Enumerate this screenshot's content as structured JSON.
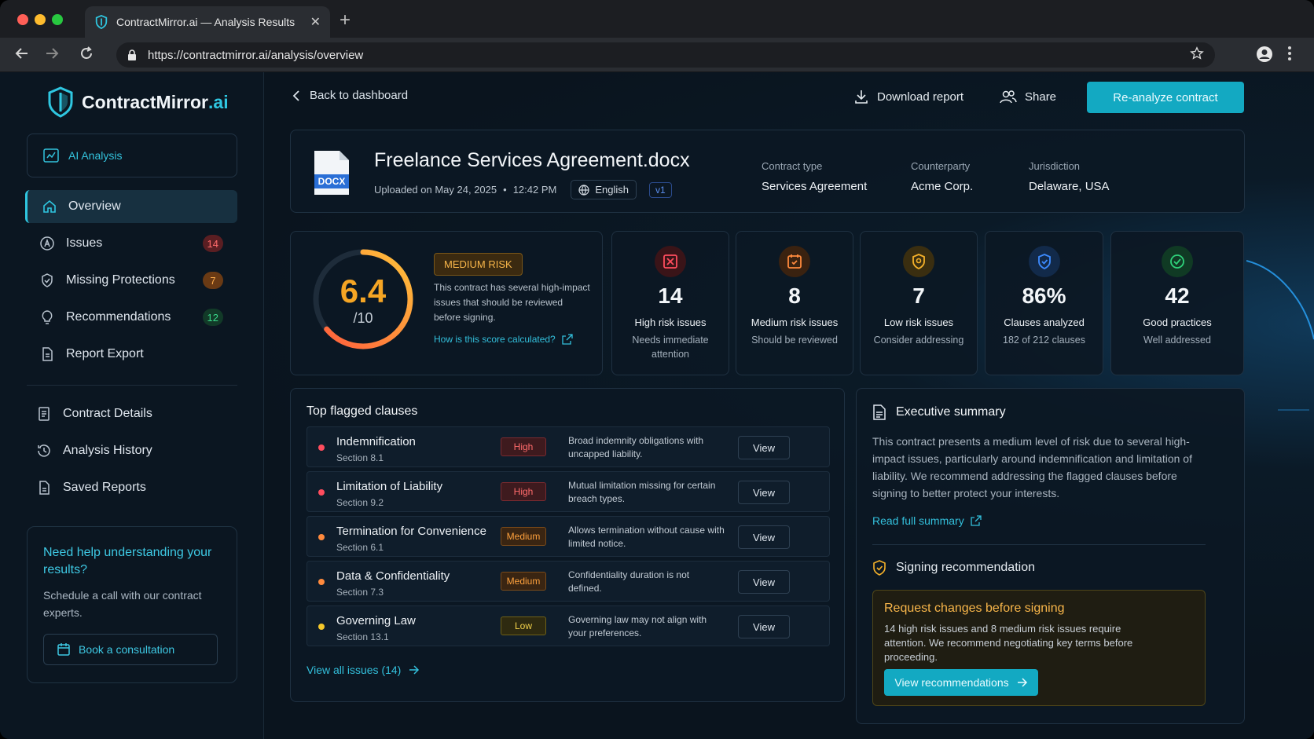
{
  "browser": {
    "tab_title": "ContractMirror.ai — Analysis Results",
    "url": "https://contractmirror.ai/analysis/overview",
    "icons": [
      "back-arrow-icon",
      "forward-arrow-icon",
      "reload-icon",
      "lock-icon",
      "star-icon",
      "profile-icon",
      "more-icon"
    ]
  },
  "brand": {
    "name": "ContractMirror",
    "suffix": ".ai",
    "accent": "#2fc6e0"
  },
  "sidebar": {
    "ai_label": "AI Analysis",
    "nav": [
      {
        "label": "Overview",
        "icon": "home-icon",
        "active": true
      },
      {
        "label": "Issues",
        "icon": "alert-icon",
        "badge": "14",
        "badge_color": "#ff6b6b"
      },
      {
        "label": "Missing Protections",
        "icon": "shield-check-icon",
        "badge": "7",
        "badge_color": "#ffae4d"
      },
      {
        "label": "Recommendations",
        "icon": "lightbulb-icon",
        "badge": "12",
        "badge_color": "#39d98a"
      },
      {
        "label": "Report Export",
        "icon": "file-icon"
      }
    ],
    "secondary": [
      {
        "label": "Contract Details",
        "icon": "document-icon"
      },
      {
        "label": "Analysis History",
        "icon": "history-icon"
      },
      {
        "label": "Saved Reports",
        "icon": "saved-file-icon"
      }
    ],
    "help": {
      "title": "Need help understanding your results?",
      "text": "Schedule a call with our contract experts.",
      "button": "Book a consultation"
    }
  },
  "topbar": {
    "back": "Back to dashboard",
    "download": "Download report",
    "share": "Share",
    "reanalyze": "Re-analyze contract"
  },
  "document": {
    "file_type": "DOCX",
    "name": "Freelance Services Agreement.docx",
    "uploaded": "Uploaded on May 24, 2025",
    "time": "12:42 PM",
    "language": "English",
    "version": "v1",
    "meta": [
      {
        "label": "Contract type",
        "value": "Services Agreement"
      },
      {
        "label": "Counterparty",
        "value": "Acme Corp."
      },
      {
        "label": "Jurisdiction",
        "value": "Delaware, USA"
      }
    ]
  },
  "score": {
    "value": "6.4",
    "max": "/10",
    "fraction": 0.64,
    "risk_label": "MEDIUM RISK",
    "description": "This contract has several high-impact issues that should be reviewed before signing.",
    "link": "How is this score calculated?"
  },
  "stats": [
    {
      "value": "14",
      "title": "High risk issues",
      "sub": "Needs immediate attention",
      "icon": "high-risk-icon",
      "color": "#ff4d5e"
    },
    {
      "value": "8",
      "title": "Medium risk issues",
      "sub": "Should be reviewed",
      "icon": "medium-risk-icon",
      "color": "#ff8a3d"
    },
    {
      "value": "7",
      "title": "Low risk issues",
      "sub": "Consider addressing",
      "icon": "low-risk-icon",
      "color": "#f5b12a"
    },
    {
      "value": "86%",
      "title": "Clauses analyzed",
      "sub": "182 of 212 clauses",
      "icon": "shield-icon",
      "color": "#3d8bff"
    },
    {
      "value": "42",
      "title": "Good practices",
      "sub": "Well addressed",
      "icon": "check-circle-icon",
      "color": "#2fd17a"
    }
  ],
  "flagged": {
    "title": "Top flagged clauses",
    "view_label": "View",
    "rows": [
      {
        "name": "Indemnification",
        "section": "Section 8.1",
        "severity": "High",
        "desc": "Broad indemnity obligations with uncapped liability."
      },
      {
        "name": "Limitation of Liability",
        "section": "Section 9.2",
        "severity": "High",
        "desc": "Mutual limitation missing for certain breach types."
      },
      {
        "name": "Termination for Convenience",
        "section": "Section 6.1",
        "severity": "Medium",
        "desc": "Allows termination without cause with limited notice."
      },
      {
        "name": "Data & Confidentiality",
        "section": "Section 7.3",
        "severity": "Medium",
        "desc": "Confidentiality duration is not defined."
      },
      {
        "name": "Governing Law",
        "section": "Section 13.1",
        "severity": "Low",
        "desc": "Governing law may not align with your preferences."
      }
    ],
    "view_all": "View all issues (14)"
  },
  "summary": {
    "title": "Executive summary",
    "text": "This contract presents a medium level of risk due to several high-impact issues, particularly around indemnification and limitation of liability. We recommend addressing the flagged clauses before signing to better protect your interests.",
    "link": "Read full summary",
    "signing_title": "Signing recommendation",
    "reco_title": "Request changes before signing",
    "reco_text": "14 high risk issues and 8 medium risk issues require attention. We recommend negotiating key terms before proceeding.",
    "reco_button": "View recommendations"
  }
}
